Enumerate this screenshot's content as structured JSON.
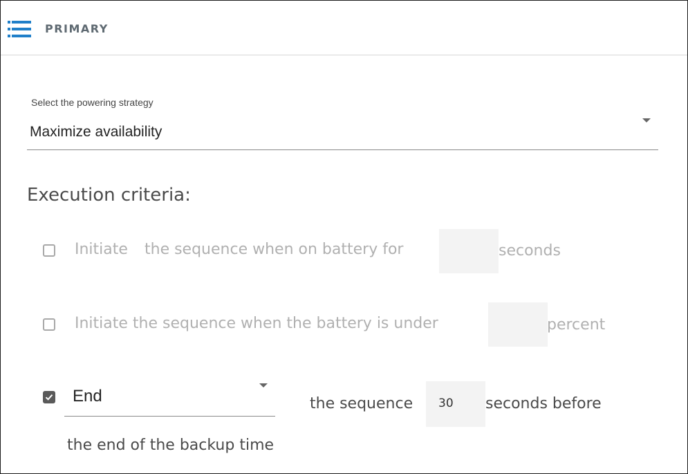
{
  "header": {
    "title": "PRIMARY",
    "menu_icon": "hamburger-menu-icon",
    "accent_color": "#1f7fc9"
  },
  "strategy": {
    "label": "Select the powering strategy",
    "selected": "Maximize availability"
  },
  "execution": {
    "title": "Execution criteria:",
    "criteria": [
      {
        "checked": false,
        "text_1": "Initiate",
        "text_2": "the sequence when on battery for",
        "value": "",
        "unit": "seconds"
      },
      {
        "checked": false,
        "text_1": "Initiate the sequence when the battery is under",
        "value": "",
        "unit": "percent"
      }
    ],
    "end": {
      "checked": true,
      "selected": "End",
      "text_1": "the sequence",
      "value": "30",
      "text_2": "seconds before",
      "text_3": "the end of the backup time"
    }
  }
}
